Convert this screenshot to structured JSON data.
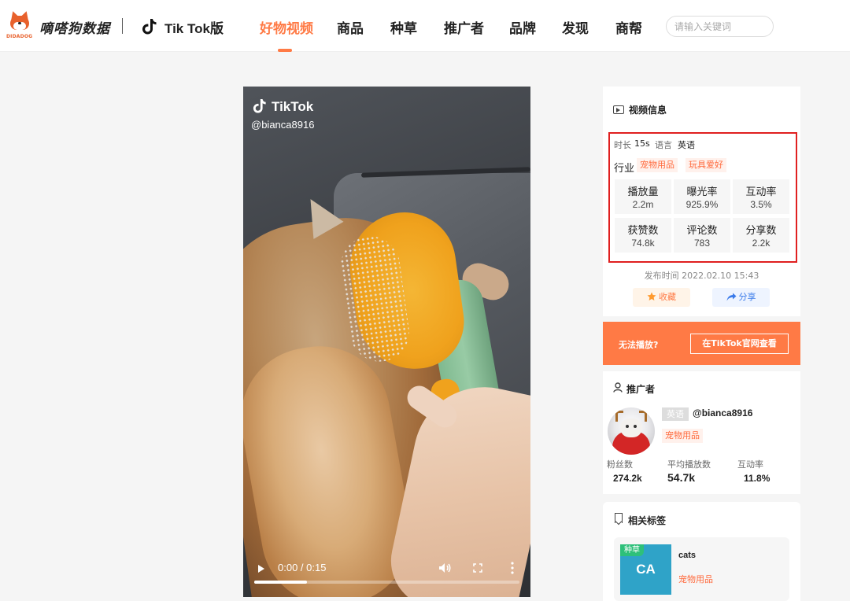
{
  "header": {
    "logo_sub": "DIDADOG",
    "brand_name": "嘀嗒狗数据",
    "platform": "Tik Tok版",
    "nav": [
      "好物视频",
      "商品",
      "种草",
      "推广者",
      "品牌",
      "发现",
      "商帮"
    ],
    "active_nav": "好物视频",
    "search_placeholder": "请输入关键词"
  },
  "video": {
    "watermark": "TikTok",
    "username": "@bianca8916",
    "time": "0:00 / 0:15",
    "progress": 0.2
  },
  "info": {
    "title": "视频信息",
    "duration_label": "时长",
    "duration": "15s",
    "language_label": "语言",
    "language": "英语",
    "industry_label": "行业",
    "industries": [
      "宠物用品",
      "玩具爱好"
    ],
    "stats": [
      {
        "label": "播放量",
        "value": "2.2m"
      },
      {
        "label": "曝光率",
        "value": "925.9%"
      },
      {
        "label": "互动率",
        "value": "3.5%"
      },
      {
        "label": "获赞数",
        "value": "74.8k"
      },
      {
        "label": "评论数",
        "value": "783"
      },
      {
        "label": "分享数",
        "value": "2.2k"
      }
    ],
    "publish_time": "发布时间 2022.02.10 15:43",
    "favorite_label": "收藏",
    "share_label": "分享"
  },
  "cant_play": {
    "text": "无法播放?",
    "button": "在TikTok官网查看"
  },
  "promoter": {
    "title": "推广者",
    "language": "英语",
    "handle": "@bianca8916",
    "category": "宠物用品",
    "stats": [
      {
        "label": "粉丝数",
        "value": "274.2k"
      },
      {
        "label": "平均播放数",
        "value": "54.7k"
      },
      {
        "label": "互动率",
        "value": "11.8%"
      }
    ]
  },
  "related_tags": {
    "title": "相关标签",
    "badge": "种草",
    "thumb_text": "CA",
    "name": "cats",
    "category": "宠物用品"
  },
  "colors": {
    "accent": "#ff7a45",
    "highlight_box": "#e02020",
    "tag_thumb": "#2fa3c8",
    "tag_badge": "#2ec07a"
  }
}
